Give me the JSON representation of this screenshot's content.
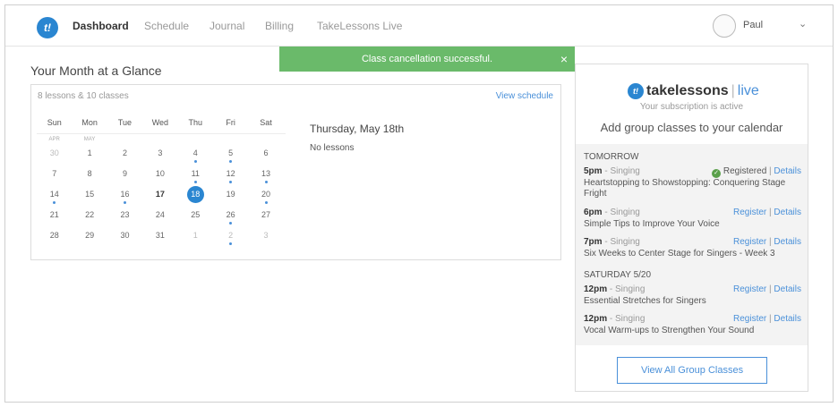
{
  "nav": {
    "logo": "t!",
    "items": [
      "Dashboard",
      "Schedule",
      "Journal",
      "Billing",
      "TakeLessons Live"
    ],
    "user_name": "Paul"
  },
  "toast": {
    "message": "Class cancellation successful.",
    "close": "×"
  },
  "month": {
    "title": "Your Month at a Glance",
    "summary": "8 lessons & 10 classes",
    "view_schedule": "View schedule",
    "weekdays": [
      "Sun",
      "Mon",
      "Tue",
      "Wed",
      "Thu",
      "Fri",
      "Sat"
    ],
    "month_labels": [
      "APR",
      "MAY"
    ],
    "weeks": [
      [
        "30",
        "1",
        "2",
        "3",
        "4",
        "5",
        "6"
      ],
      [
        "7",
        "8",
        "9",
        "10",
        "11",
        "12",
        "13"
      ],
      [
        "14",
        "15",
        "16",
        "17",
        "18",
        "19",
        "20"
      ],
      [
        "21",
        "22",
        "23",
        "24",
        "25",
        "26",
        "27"
      ],
      [
        "28",
        "29",
        "30",
        "31",
        "1",
        "2",
        "3"
      ]
    ],
    "selected_day_title": "Thursday, May 18th",
    "no_lessons": "No lessons"
  },
  "panel": {
    "brand": {
      "logo": "t!",
      "take": "takelessons",
      "sep": "|",
      "live": "live"
    },
    "subscription": "Your subscription is active",
    "add_group": "Add group classes to your calendar",
    "groups": [
      {
        "heading": "TOMORROW",
        "classes": [
          {
            "time": "5pm",
            "category": "Singing",
            "title": "Heartstopping to Showstopping: Conquering Stage Fright",
            "status": "Registered",
            "details": "Details"
          },
          {
            "time": "6pm",
            "category": "Singing",
            "title": "Simple Tips to Improve Your Voice",
            "action": "Register",
            "details": "Details"
          },
          {
            "time": "7pm",
            "category": "Singing",
            "title": "Six Weeks to Center Stage for Singers - Week 3",
            "action": "Register",
            "details": "Details"
          }
        ]
      },
      {
        "heading": "SATURDAY 5/20",
        "classes": [
          {
            "time": "12pm",
            "category": "Singing",
            "title": "Essential Stretches for Singers",
            "action": "Register",
            "details": "Details"
          },
          {
            "time": "12pm",
            "category": "Singing",
            "title": "Vocal Warm-ups to Strengthen Your Sound",
            "action": "Register",
            "details": "Details"
          }
        ]
      }
    ],
    "dash": " - ",
    "pipe": "|",
    "view_all": "View All Group Classes"
  },
  "colors": {
    "brand_blue": "#2a86d1",
    "link": "#4a90d9",
    "toast": "#6aba6a"
  }
}
